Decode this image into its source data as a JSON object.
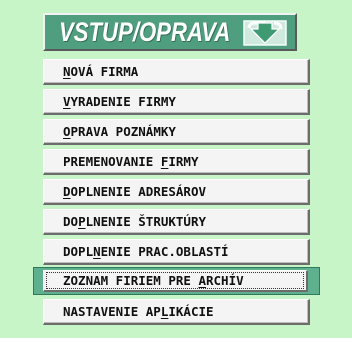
{
  "header": {
    "title": "VSTUP/OPRAVA",
    "icon": "down-arrow-icon"
  },
  "menu": {
    "items": [
      {
        "pre": "",
        "key": "N",
        "post": "OVÁ FIRMA"
      },
      {
        "pre": "",
        "key": "V",
        "post": "YRADENIE FIRMY"
      },
      {
        "pre": "",
        "key": "O",
        "post": "PRAVA POZNÁMKY"
      },
      {
        "pre": "PREMENOVANIE ",
        "key": "F",
        "post": "IRMY"
      },
      {
        "pre": "",
        "key": "D",
        "post": "OPLNENIE ADRESÁROV"
      },
      {
        "pre": "DO",
        "key": "P",
        "post": "LNENIE ŠTRUKTÚRY"
      },
      {
        "pre": "DOPL",
        "key": "N",
        "post": "ENIE PRAC.OBLASTÍ"
      },
      {
        "pre": "ZOZNAM FIRIEM PRE ",
        "key": "A",
        "post": "RCHÍV"
      },
      {
        "pre": "NASTAVENIE AP",
        "key": "L",
        "post": "IKÁCIE"
      }
    ],
    "selected_index": 7
  },
  "colors": {
    "background": "#c8f5c8",
    "header": "#4f9e80",
    "selection": "#5fb08f"
  }
}
